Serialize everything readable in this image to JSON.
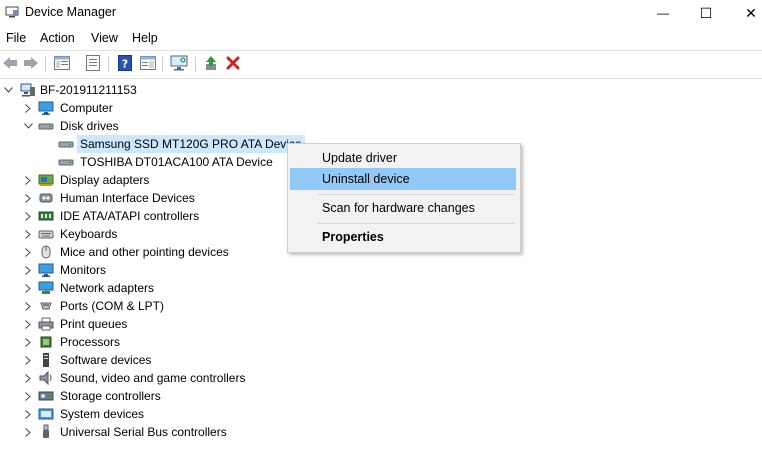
{
  "window": {
    "title": "Device Manager",
    "minimize": "—",
    "maximize": "☐",
    "close": "✕"
  },
  "menu": [
    "File",
    "Action",
    "View",
    "Help"
  ],
  "toolbar": {
    "buttons": [
      "back-arrow",
      "forward-arrow",
      "properties-sheet",
      "hide-show-console-tree",
      "help",
      "view-list",
      "scan-monitor",
      "update-driver",
      "uninstall-x"
    ]
  },
  "tree": {
    "root": "BF-201911211153",
    "categories": [
      {
        "label": "Computer",
        "icon": "monitor-icon",
        "expanded": false
      },
      {
        "label": "Disk drives",
        "icon": "disk-icon",
        "expanded": true,
        "children": [
          "Samsung SSD MT120G PRO ATA Device",
          "TOSHIBA DT01ACA100 ATA Device"
        ]
      },
      {
        "label": "Display adapters",
        "icon": "display-adapter-icon"
      },
      {
        "label": "Human Interface Devices",
        "icon": "hid-icon"
      },
      {
        "label": "IDE ATA/ATAPI controllers",
        "icon": "ide-icon"
      },
      {
        "label": "Keyboards",
        "icon": "keyboard-icon"
      },
      {
        "label": "Mice and other pointing devices",
        "icon": "mouse-icon"
      },
      {
        "label": "Monitors",
        "icon": "monitor-icon"
      },
      {
        "label": "Network adapters",
        "icon": "network-icon"
      },
      {
        "label": "Ports (COM & LPT)",
        "icon": "port-icon"
      },
      {
        "label": "Print queues",
        "icon": "printer-icon"
      },
      {
        "label": "Processors",
        "icon": "processor-icon"
      },
      {
        "label": "Software devices",
        "icon": "software-icon"
      },
      {
        "label": "Sound, video and game controllers",
        "icon": "speaker-icon"
      },
      {
        "label": "Storage controllers",
        "icon": "storage-icon"
      },
      {
        "label": "System devices",
        "icon": "system-icon"
      },
      {
        "label": "Universal Serial Bus controllers",
        "icon": "usb-icon"
      }
    ]
  },
  "context_menu": {
    "items": [
      "Update driver",
      "Uninstall device",
      "Scan for hardware changes",
      "Properties"
    ],
    "highlighted": "Uninstall device"
  }
}
